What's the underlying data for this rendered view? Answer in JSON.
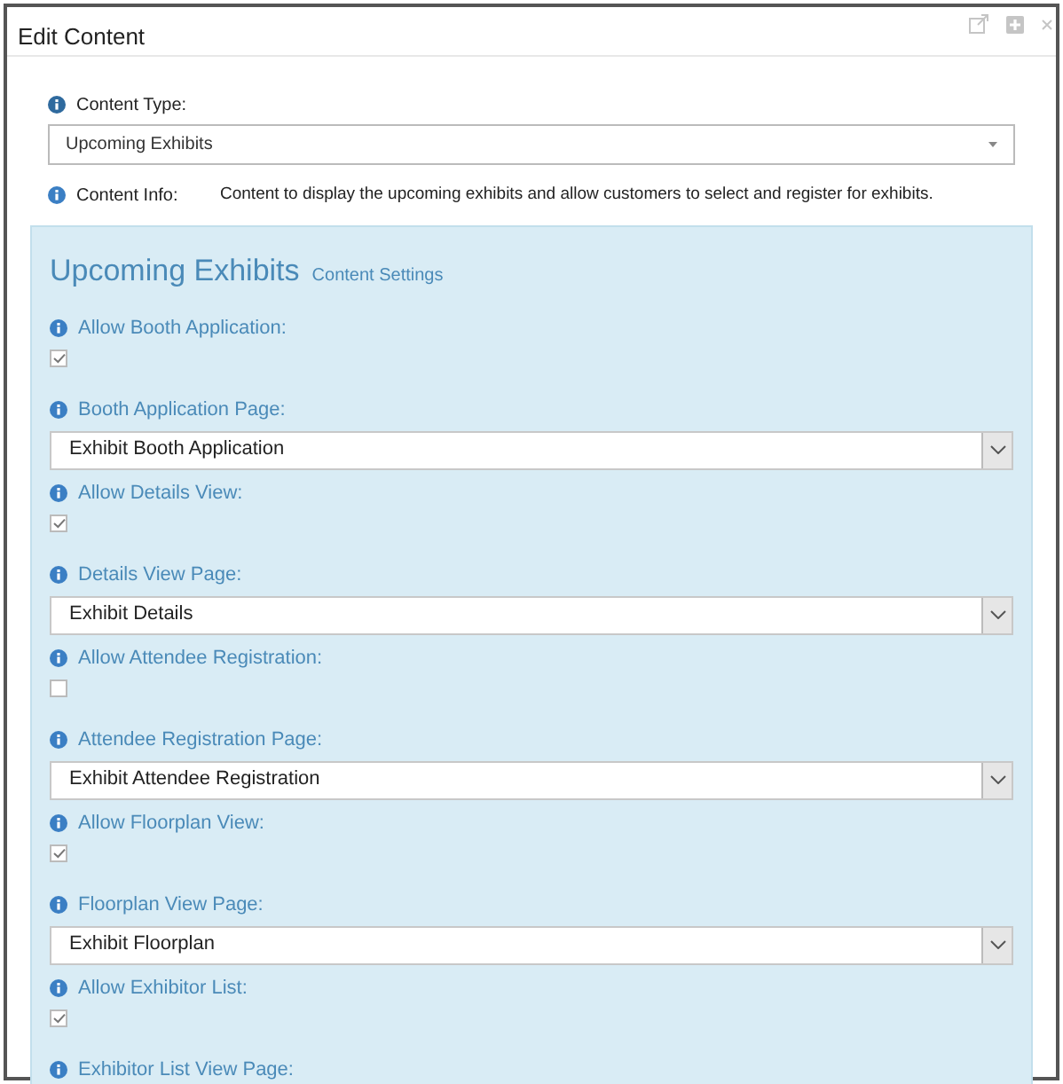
{
  "window": {
    "title": "Edit Content"
  },
  "content_type": {
    "label": "Content Type:",
    "value": "Upcoming Exhibits"
  },
  "content_info": {
    "label": "Content Info:",
    "text": "Content to display the upcoming exhibits and allow customers to select and register for exhibits."
  },
  "settings": {
    "title": "Upcoming Exhibits",
    "subtitle": "Content Settings",
    "fields": [
      {
        "kind": "checkbox",
        "label": "Allow Booth Application:",
        "checked": true
      },
      {
        "kind": "select",
        "label": "Booth Application Page:",
        "value": "Exhibit Booth Application"
      },
      {
        "kind": "checkbox",
        "label": "Allow Details View:",
        "checked": true
      },
      {
        "kind": "select",
        "label": "Details View Page:",
        "value": "Exhibit Details"
      },
      {
        "kind": "checkbox",
        "label": "Allow Attendee Registration:",
        "checked": false
      },
      {
        "kind": "select",
        "label": "Attendee Registration Page:",
        "value": "Exhibit Attendee Registration"
      },
      {
        "kind": "checkbox",
        "label": "Allow Floorplan View:",
        "checked": true
      },
      {
        "kind": "select",
        "label": "Floorplan View Page:",
        "value": "Exhibit Floorplan"
      },
      {
        "kind": "checkbox",
        "label": "Allow Exhibitor List:",
        "checked": true
      },
      {
        "kind": "label",
        "label": "Exhibitor List View Page:"
      }
    ]
  }
}
